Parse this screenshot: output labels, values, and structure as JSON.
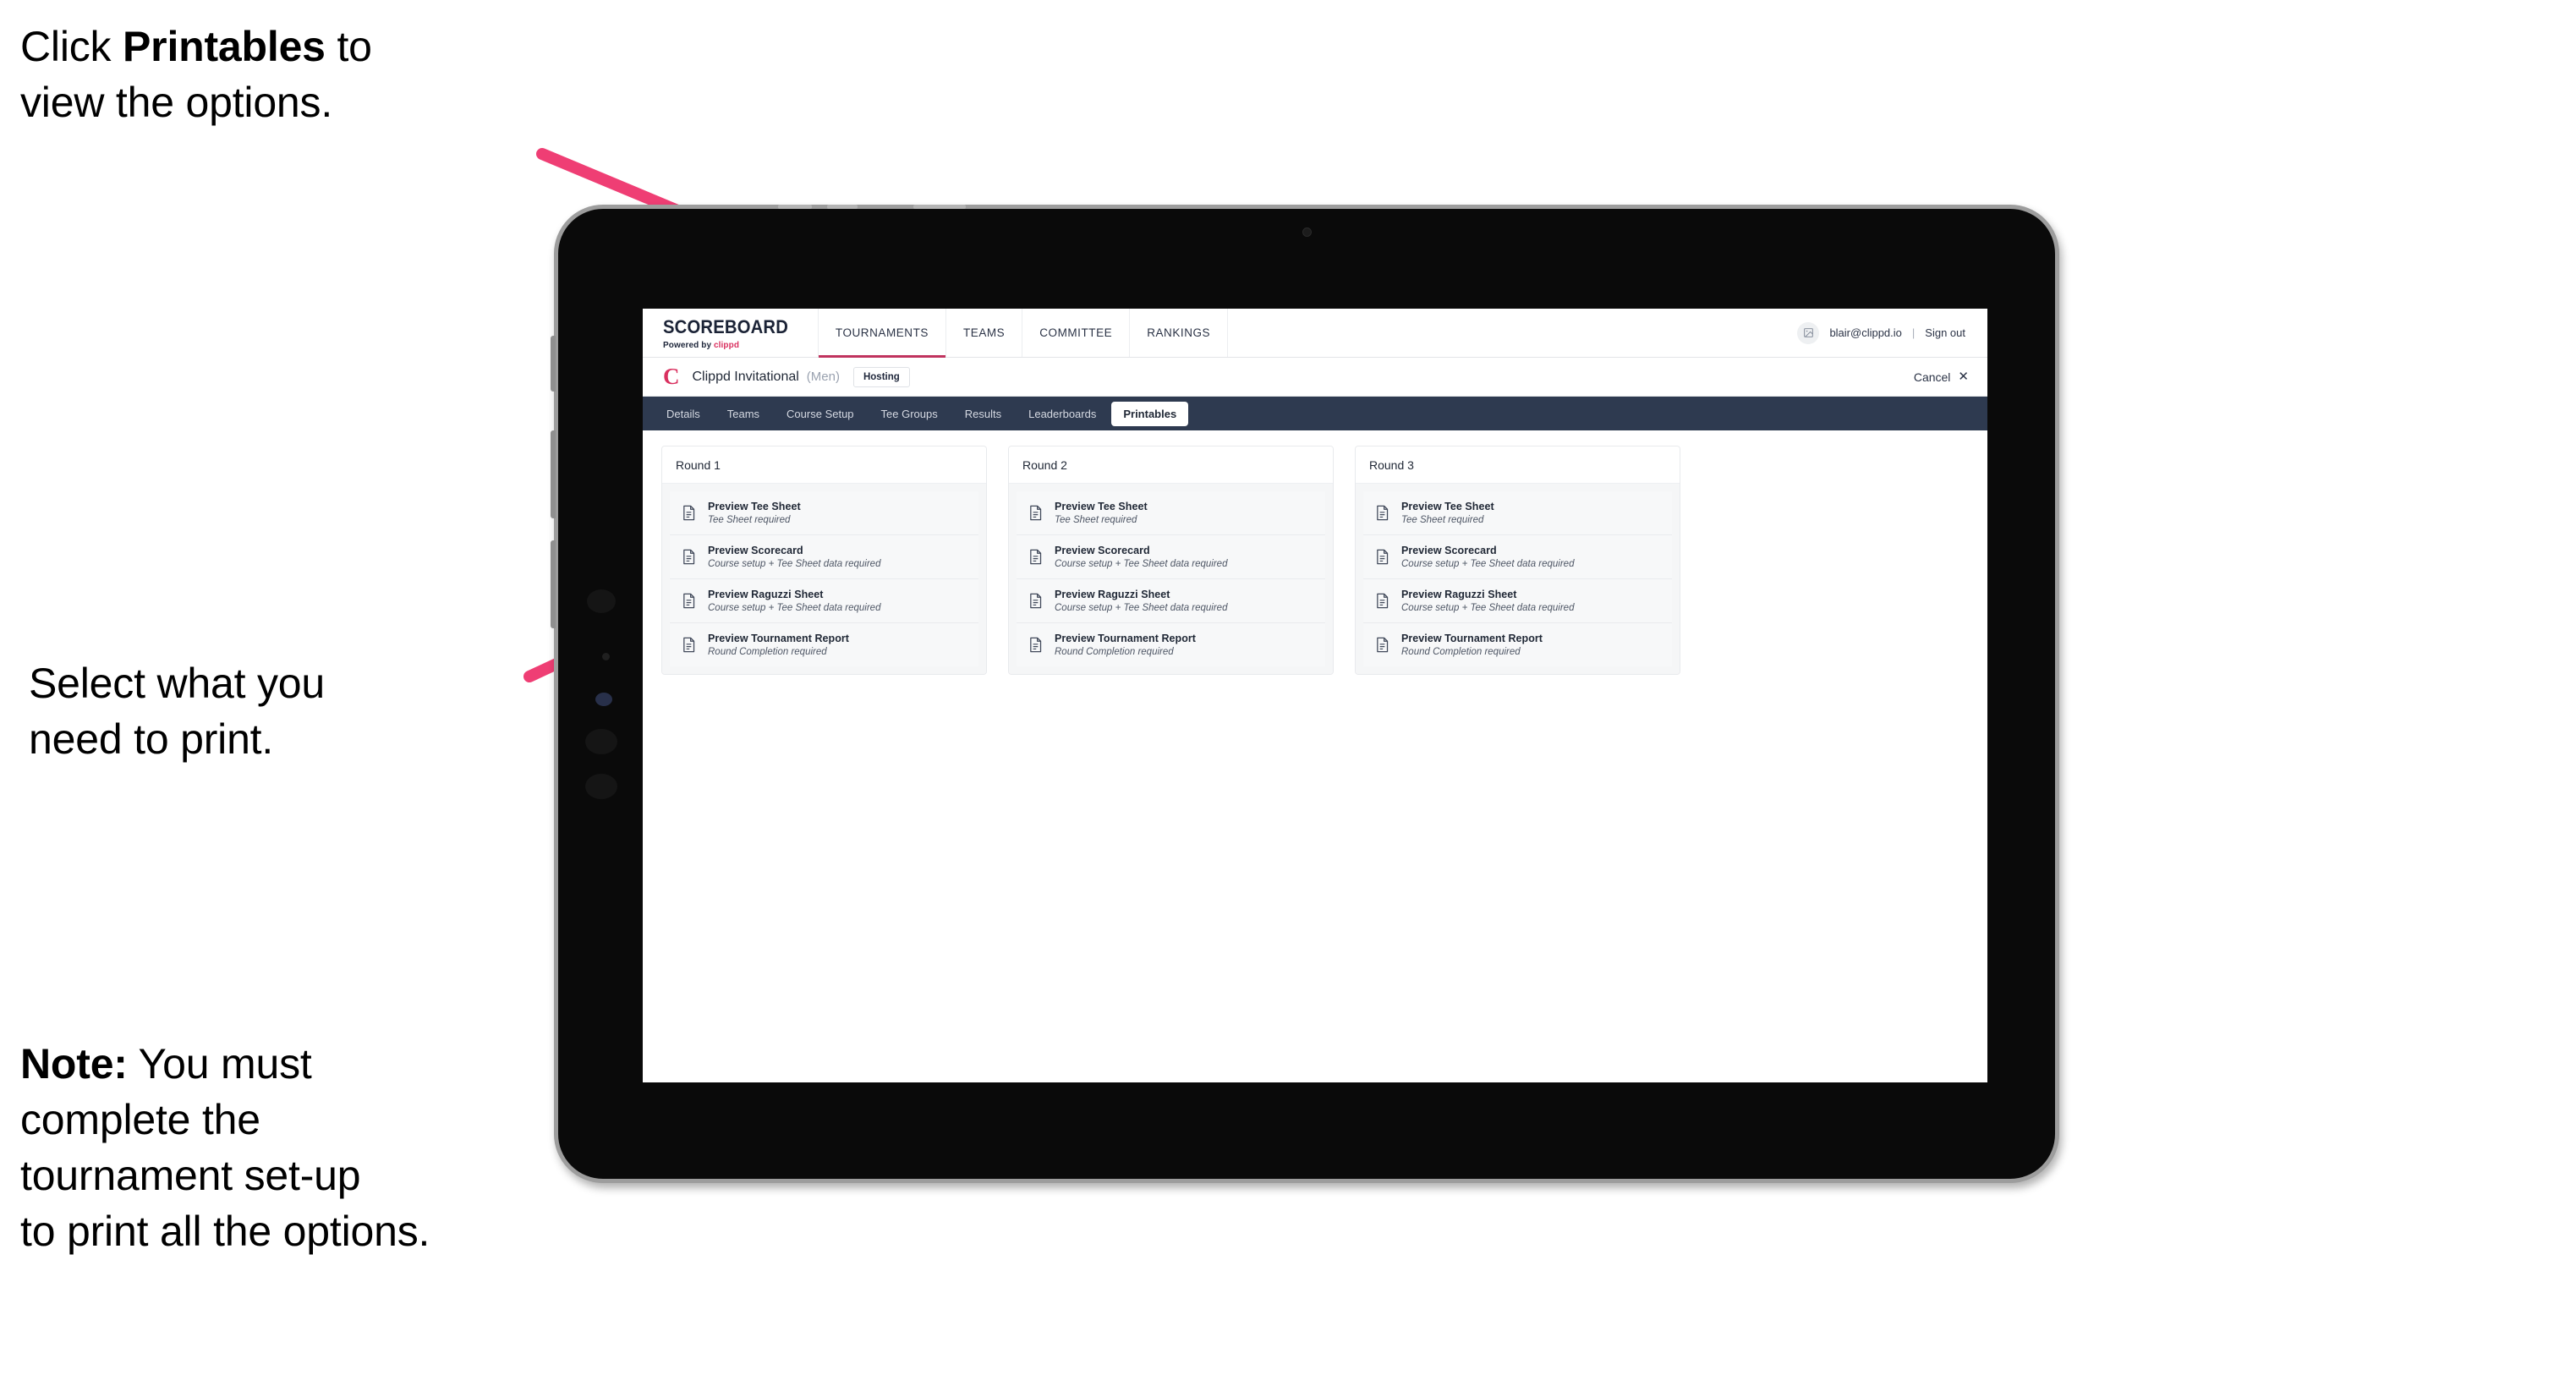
{
  "colors": {
    "accent_pink": "#ef3e74",
    "brand_crimson": "#d9305f",
    "nav_active_underline": "#c0335e",
    "tab_bar_dark": "#2e3a50"
  },
  "annotations": [
    {
      "id": "callout-printables",
      "text_before": "Click ",
      "bold": "Printables",
      "text_after": " to\nview the options."
    },
    {
      "id": "callout-select",
      "text_before": "Select what you\n need to print.",
      "bold": "",
      "text_after": ""
    },
    {
      "id": "callout-note",
      "text_before": "",
      "bold": "Note:",
      "text_after": " You must\ncomplete the\ntournament set-up\nto print all the options."
    }
  ],
  "app": {
    "top_nav": {
      "brand": {
        "word": "SCOREBOARD",
        "sub_prefix": "Powered by ",
        "sub_mark": "clippd"
      },
      "items": [
        {
          "label": "TOURNAMENTS",
          "active": true
        },
        {
          "label": "TEAMS",
          "active": false
        },
        {
          "label": "COMMITTEE",
          "active": false
        },
        {
          "label": "RANKINGS",
          "active": false
        }
      ],
      "account": {
        "avatar_icon": "user-image-icon",
        "email": "blair@clippd.io",
        "divider": "|",
        "sign_out": "Sign out"
      }
    },
    "tournament_bar": {
      "logo_letter": "C",
      "name": "Clippd Invitational",
      "gender": "(Men)",
      "badge": "Hosting",
      "cancel_label": "Cancel",
      "cancel_icon": "close-icon"
    },
    "section_tabs": [
      {
        "label": "Details",
        "active": false
      },
      {
        "label": "Teams",
        "active": false
      },
      {
        "label": "Course Setup",
        "active": false
      },
      {
        "label": "Tee Groups",
        "active": false
      },
      {
        "label": "Results",
        "active": false
      },
      {
        "label": "Leaderboards",
        "active": false
      },
      {
        "label": "Printables",
        "active": true
      }
    ],
    "rounds": [
      {
        "header": "Round 1",
        "items": [
          {
            "title": "Preview Tee Sheet",
            "requirement": "Tee Sheet required"
          },
          {
            "title": "Preview Scorecard",
            "requirement": "Course setup + Tee Sheet data required"
          },
          {
            "title": "Preview Raguzzi Sheet",
            "requirement": "Course setup + Tee Sheet data required"
          },
          {
            "title": "Preview Tournament Report",
            "requirement": "Round Completion required"
          }
        ]
      },
      {
        "header": "Round 2",
        "items": [
          {
            "title": "Preview Tee Sheet",
            "requirement": "Tee Sheet required"
          },
          {
            "title": "Preview Scorecard",
            "requirement": "Course setup + Tee Sheet data required"
          },
          {
            "title": "Preview Raguzzi Sheet",
            "requirement": "Course setup + Tee Sheet data required"
          },
          {
            "title": "Preview Tournament Report",
            "requirement": "Round Completion required"
          }
        ]
      },
      {
        "header": "Round 3",
        "items": [
          {
            "title": "Preview Tee Sheet",
            "requirement": "Tee Sheet required"
          },
          {
            "title": "Preview Scorecard",
            "requirement": "Course setup + Tee Sheet data required"
          },
          {
            "title": "Preview Raguzzi Sheet",
            "requirement": "Course setup + Tee Sheet data required"
          },
          {
            "title": "Preview Tournament Report",
            "requirement": "Round Completion required"
          }
        ]
      }
    ]
  }
}
